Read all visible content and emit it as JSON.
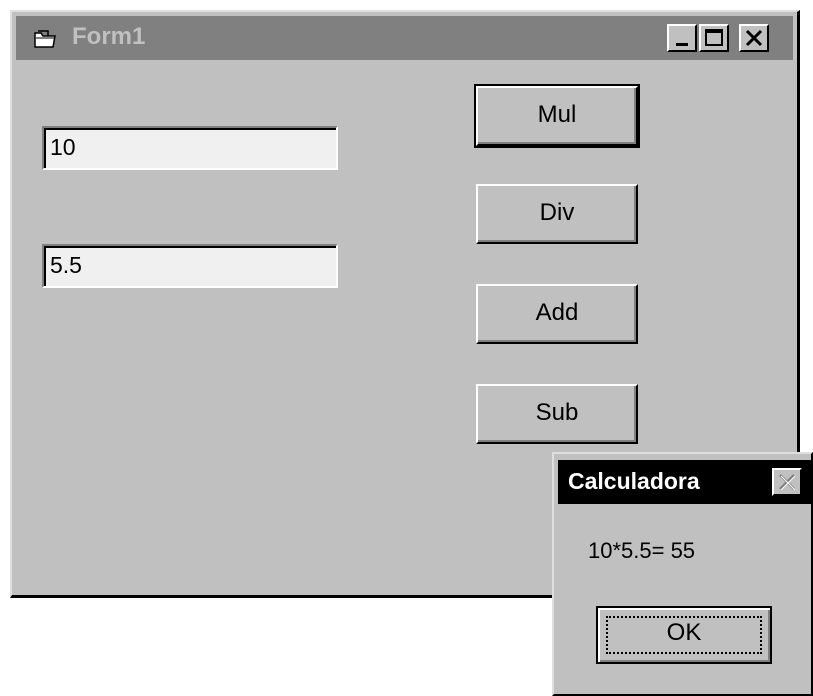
{
  "window": {
    "title": "Form1",
    "icon": "form-icon",
    "controls": {
      "minimize": "minimize-icon",
      "maximize": "maximize-icon",
      "close": "close-icon"
    }
  },
  "inputs": [
    {
      "value": "10"
    },
    {
      "value": "5.5"
    }
  ],
  "buttons": {
    "mul": "Mul",
    "div": "Div",
    "add": "Add",
    "sub": "Sub"
  },
  "dialog": {
    "title": "Calculadora",
    "message": "10*5.5= 55",
    "ok_label": "OK"
  },
  "colors": {
    "face": "#c0c0c0",
    "inactive_title": "#808080",
    "active_title": "#000000"
  }
}
